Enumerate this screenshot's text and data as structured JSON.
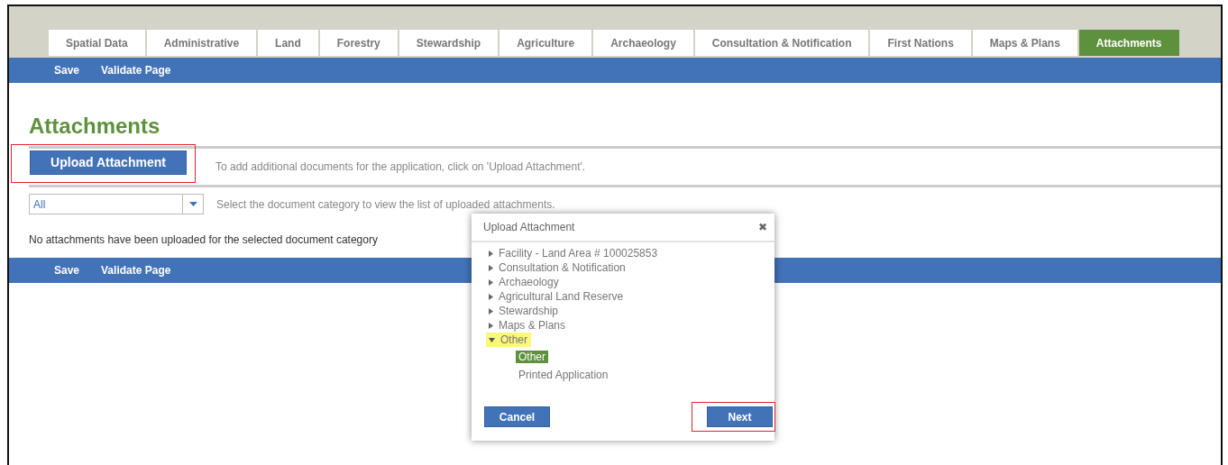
{
  "tabs": [
    {
      "label": "Spatial Data",
      "selected": false
    },
    {
      "label": "Administrative",
      "selected": false
    },
    {
      "label": "Land",
      "selected": false
    },
    {
      "label": "Forestry",
      "selected": false
    },
    {
      "label": "Stewardship",
      "selected": false
    },
    {
      "label": "Agriculture",
      "selected": false
    },
    {
      "label": "Archaeology",
      "selected": false
    },
    {
      "label": "Consultation & Notification",
      "selected": false
    },
    {
      "label": "First Nations",
      "selected": false
    },
    {
      "label": "Maps & Plans",
      "selected": false
    },
    {
      "label": "Attachments",
      "selected": true
    }
  ],
  "top_actions": [
    "Save",
    "Validate Page"
  ],
  "page_title": "Attachments",
  "upload_button": "Upload Attachment",
  "upload_hint": "To add additional documents for the application, click on 'Upload Attachment'.",
  "category_select": {
    "value": "All"
  },
  "category_hint": "Select the document category to view the list of uploaded attachments.",
  "empty_message": "No attachments have been uploaded for the selected document category",
  "bottom_actions": [
    "Save",
    "Validate Page"
  ],
  "dialog": {
    "title": "Upload Attachment",
    "close": "✖",
    "tree": [
      {
        "label": "Facility - Land Area # 100025853",
        "expanded": false,
        "highlighted": false
      },
      {
        "label": "Consultation & Notification",
        "expanded": false,
        "highlighted": false
      },
      {
        "label": "Archaeology",
        "expanded": false,
        "highlighted": false
      },
      {
        "label": "Agricultural Land Reserve",
        "expanded": false,
        "highlighted": false
      },
      {
        "label": "Stewardship",
        "expanded": false,
        "highlighted": false
      },
      {
        "label": "Maps & Plans",
        "expanded": false,
        "highlighted": false
      },
      {
        "label": "Other",
        "expanded": true,
        "highlighted": true,
        "children": [
          {
            "label": "Other",
            "selected": true
          },
          {
            "label": "Printed Application",
            "selected": false
          }
        ]
      }
    ],
    "cancel": "Cancel",
    "next": "Next"
  }
}
